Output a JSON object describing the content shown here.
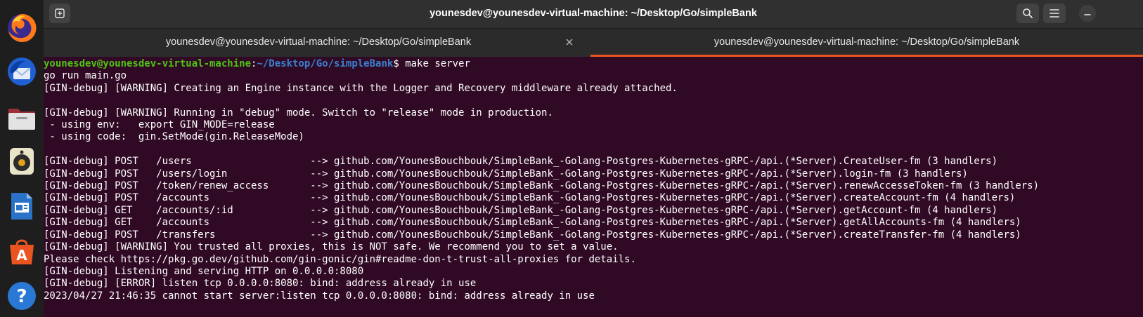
{
  "window": {
    "title": "younesdev@younesdev-virtual-machine: ~/Desktop/Go/simpleBank"
  },
  "tabs": [
    {
      "label": "younesdev@younesdev-virtual-machine: ~/Desktop/Go/simpleBank",
      "active": false
    },
    {
      "label": "younesdev@younesdev-virtual-machine: ~/Desktop/Go/simpleBank",
      "active": true
    }
  ],
  "dock": [
    {
      "name": "firefox-icon"
    },
    {
      "name": "thunderbird-icon"
    },
    {
      "name": "files-icon"
    },
    {
      "name": "rhythmbox-icon"
    },
    {
      "name": "libreoffice-writer-icon"
    },
    {
      "name": "app-center-icon"
    },
    {
      "name": "help-icon"
    }
  ],
  "colors": {
    "terminal_bg": "#300a24",
    "prompt_user": "#4fc414",
    "prompt_path": "#3a80d0",
    "tab_accent": "#e95420"
  },
  "terminal": {
    "prompt": {
      "user_host": "younesdev@younesdev-virtual-machine",
      "sep": ":",
      "path": "~/Desktop/Go/simpleBank",
      "symbol": "$ ",
      "command": "make server"
    },
    "lines": [
      "go run main.go",
      "[GIN-debug] [WARNING] Creating an Engine instance with the Logger and Recovery middleware already attached.",
      "",
      "[GIN-debug] [WARNING] Running in \"debug\" mode. Switch to \"release\" mode in production.",
      " - using env:   export GIN_MODE=release",
      " - using code:  gin.SetMode(gin.ReleaseMode)",
      "",
      "[GIN-debug] POST   /users                    --> github.com/YounesBouchbouk/SimpleBank_-Golang-Postgres-Kubernetes-gRPC-/api.(*Server).CreateUser-fm (3 handlers)",
      "[GIN-debug] POST   /users/login              --> github.com/YounesBouchbouk/SimpleBank_-Golang-Postgres-Kubernetes-gRPC-/api.(*Server).login-fm (3 handlers)",
      "[GIN-debug] POST   /token/renew_access       --> github.com/YounesBouchbouk/SimpleBank_-Golang-Postgres-Kubernetes-gRPC-/api.(*Server).renewAccesseToken-fm (3 handlers)",
      "[GIN-debug] POST   /accounts                 --> github.com/YounesBouchbouk/SimpleBank_-Golang-Postgres-Kubernetes-gRPC-/api.(*Server).createAccount-fm (4 handlers)",
      "[GIN-debug] GET    /accounts/:id             --> github.com/YounesBouchbouk/SimpleBank_-Golang-Postgres-Kubernetes-gRPC-/api.(*Server).getAccount-fm (4 handlers)",
      "[GIN-debug] GET    /accounts                 --> github.com/YounesBouchbouk/SimpleBank_-Golang-Postgres-Kubernetes-gRPC-/api.(*Server).getAllAccounts-fm (4 handlers)",
      "[GIN-debug] POST   /transfers                --> github.com/YounesBouchbouk/SimpleBank_-Golang-Postgres-Kubernetes-gRPC-/api.(*Server).createTransfer-fm (4 handlers)",
      "[GIN-debug] [WARNING] You trusted all proxies, this is NOT safe. We recommend you to set a value.",
      "Please check https://pkg.go.dev/github.com/gin-gonic/gin#readme-don-t-trust-all-proxies for details.",
      "[GIN-debug] Listening and serving HTTP on 0.0.0.0:8080",
      "[GIN-debug] [ERROR] listen tcp 0.0.0.0:8080: bind: address already in use",
      "2023/04/27 21:46:35 cannot start server:listen tcp 0.0.0.0:8080: bind: address already in use"
    ]
  }
}
